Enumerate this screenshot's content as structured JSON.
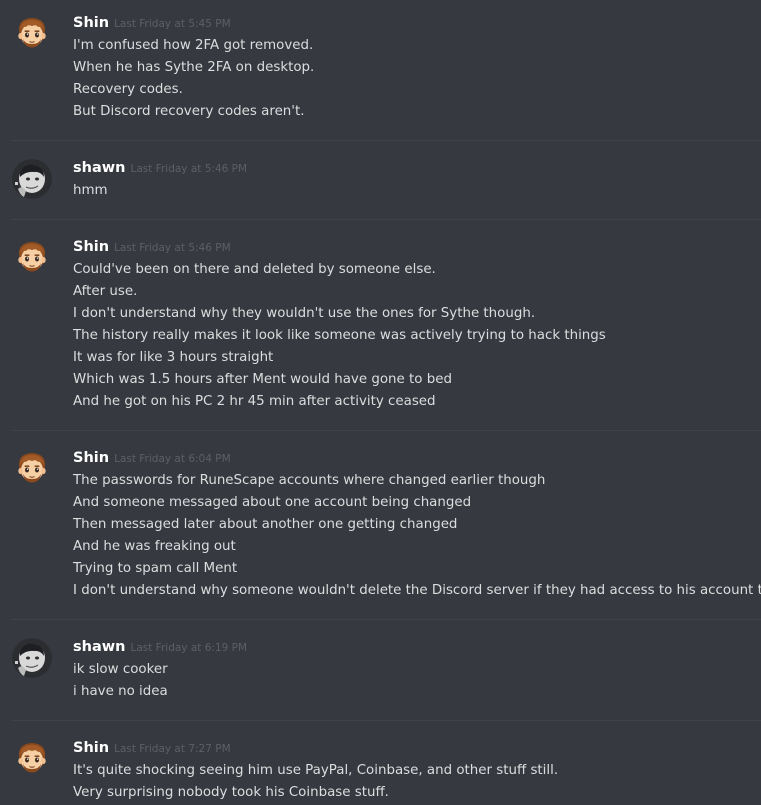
{
  "messages": [
    {
      "author": "Shin",
      "avatar": "shin-avatar",
      "timestamp": "Last Friday at 5:45 PM",
      "lines": [
        "I'm confused how 2FA got removed.",
        "When he has Sythe 2FA on desktop.",
        "Recovery codes.",
        "But Discord recovery codes aren't."
      ]
    },
    {
      "author": "shawn",
      "avatar": "shawn-avatar",
      "timestamp": "Last Friday at 5:46 PM",
      "lines": [
        "hmm"
      ]
    },
    {
      "author": "Shin",
      "avatar": "shin-avatar",
      "timestamp": "Last Friday at 5:46 PM",
      "lines": [
        "Could've been on there and deleted by someone else.",
        "After use.",
        "I don't understand why they wouldn't use the ones for Sythe though.",
        "The history really makes it look like someone was actively trying to hack things",
        "It was for like 3 hours straight",
        "Which was 1.5 hours after Ment would have gone to bed",
        "And he got on his PC 2 hr 45 min after activity ceased"
      ]
    },
    {
      "author": "Shin",
      "avatar": "shin-avatar",
      "timestamp": "Last Friday at 6:04 PM",
      "lines": [
        "The passwords for RuneScape accounts where changed earlier though",
        "And someone messaged about one account being changed",
        "Then messaged later about another one getting changed",
        "And he was freaking out",
        "Trying to spam call Ment",
        "I don't understand why someone wouldn't delete the Discord server if they had access to his account though"
      ]
    },
    {
      "author": "shawn",
      "avatar": "shawn-avatar",
      "timestamp": "Last Friday at 6:19 PM",
      "lines": [
        "ik slow cooker",
        "i have no idea"
      ]
    },
    {
      "author": "Shin",
      "avatar": "shin-avatar",
      "timestamp": "Last Friday at 7:27 PM",
      "lines": [
        "It's quite shocking seeing him use PayPal, Coinbase, and other stuff still.",
        "Very surprising nobody took his Coinbase stuff."
      ]
    }
  ],
  "colors": {
    "background": "#36393f",
    "username": "#ffffff",
    "timestamp": "#5c6066",
    "message_text": "#dcddde",
    "divider": "#40434a"
  }
}
